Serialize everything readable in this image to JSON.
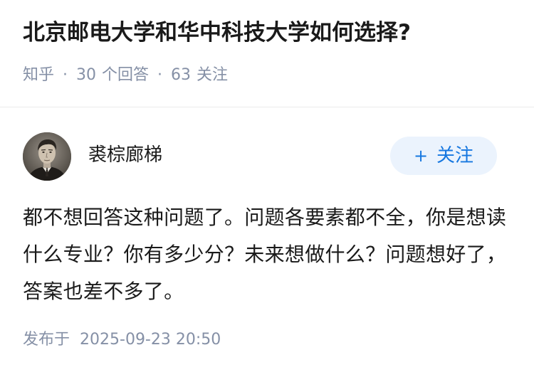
{
  "question": {
    "title": "北京邮电大学和华中科技大学如何选择?",
    "source": "知乎",
    "answer_count": "30",
    "answer_label": "个回答",
    "follow_count": "63",
    "follow_label": "关注"
  },
  "answer": {
    "author_name": "裘棕廊梯",
    "avatar_icon": "author-photo-avatar",
    "follow_button_label": "关注",
    "follow_button_icon": "plus-icon",
    "content": "都不想回答这种问题了。问题各要素都不全，你是想读什么专业？你有多少分？未来想做什么？问题想好了，答案也差不多了。",
    "published_label": "发布于",
    "published_time": "2025-09-23 20:50"
  },
  "colors": {
    "meta_text": "#8590a6",
    "follow_bg": "#ebf3fd",
    "follow_text": "#1677e0",
    "divider": "#ebebeb"
  }
}
